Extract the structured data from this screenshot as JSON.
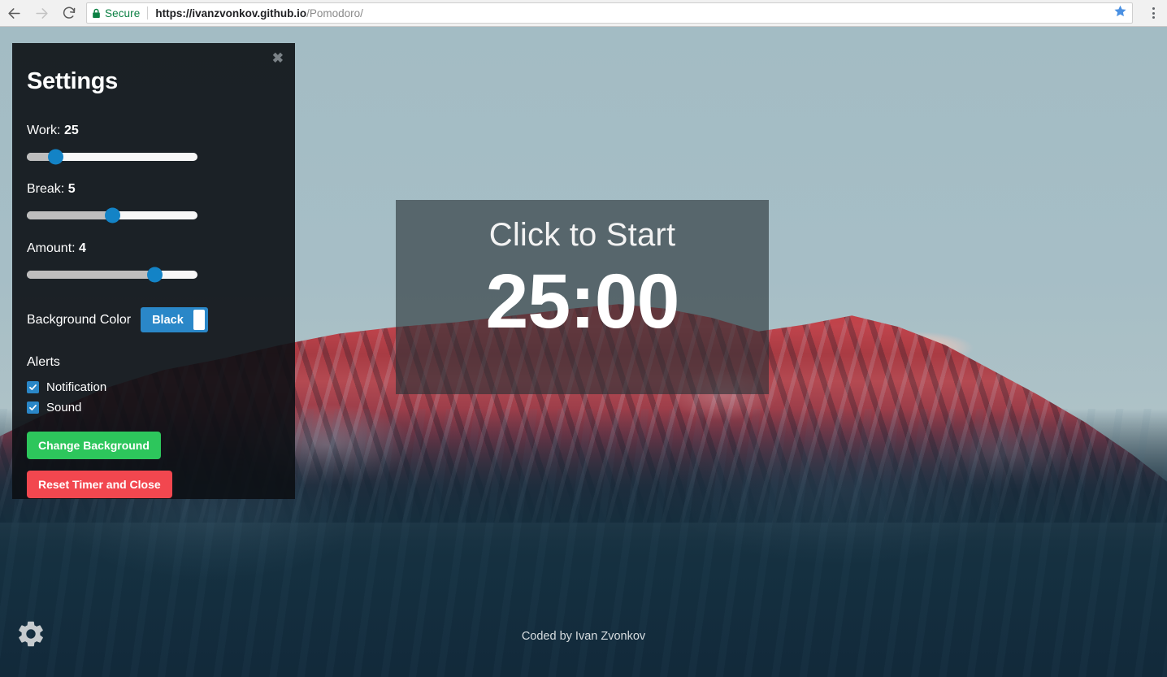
{
  "browser": {
    "back_icon": "back-arrow-icon",
    "forward_icon": "forward-arrow-icon",
    "reload_icon": "reload-icon",
    "security_label": "Secure",
    "lock_icon": "lock-icon",
    "url_origin": "https://ivanzvonkov.github.io",
    "url_path": "/Pomodoro/",
    "star_icon": "star-icon",
    "menu_icon": "three-dot-menu-icon"
  },
  "settings": {
    "title": "Settings",
    "close_label": "✖",
    "work": {
      "label": "Work:",
      "value": "25",
      "fill_percent": 17,
      "thumb_percent": 17
    },
    "break": {
      "label": "Break:",
      "value": "5",
      "fill_percent": 50,
      "thumb_percent": 50
    },
    "amount": {
      "label": "Amount:",
      "value": "4",
      "fill_percent": 75,
      "thumb_percent": 75
    },
    "background_color": {
      "label": "Background Color",
      "selected": "Black",
      "options": [
        "Black"
      ]
    },
    "alerts": {
      "heading": "Alerts",
      "notification_label": "Notification",
      "notification_checked": true,
      "sound_label": "Sound",
      "sound_checked": true
    },
    "change_background_button": "Change Background",
    "reset_button": "Reset Timer and Close",
    "accent_blue": "#2a87c8",
    "green": "#2dc65c",
    "red": "#f2474f"
  },
  "timer": {
    "caption": "Click to Start",
    "value": "25:00"
  },
  "footer": {
    "credit": "Coded by Ivan Zvonkov"
  },
  "gear_button": {
    "icon": "gear-icon"
  }
}
